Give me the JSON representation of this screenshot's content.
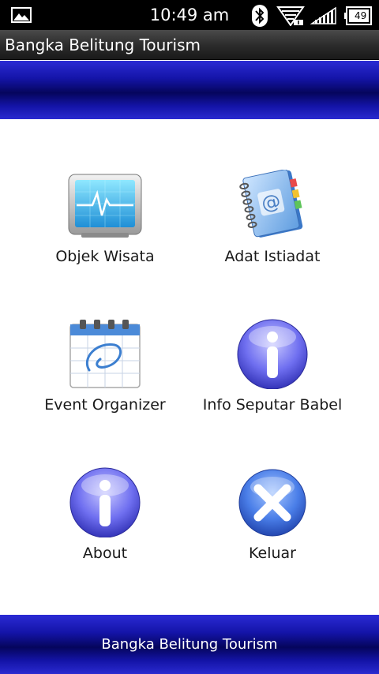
{
  "status_bar": {
    "time": "10:49 am",
    "battery_level": "49",
    "icons": [
      "gallery-icon",
      "bluetooth-icon",
      "wifi-icon",
      "signal-icon",
      "battery-icon"
    ]
  },
  "app": {
    "title": "Bangka Belitung Tourism"
  },
  "menu": [
    {
      "label": "Objek Wisata",
      "icon": "monitor-heartbeat-icon"
    },
    {
      "label": "Adat Istiadat",
      "icon": "address-book-icon"
    },
    {
      "label": "Event Organizer",
      "icon": "calendar-icon"
    },
    {
      "label": "Info Seputar Babel",
      "icon": "info-icon"
    },
    {
      "label": "About",
      "icon": "info-icon"
    },
    {
      "label": "Keluar",
      "icon": "close-icon"
    }
  ],
  "footer": {
    "text": "Bangka Belitung Tourism"
  },
  "colors": {
    "banner_blue": "#1414a8",
    "banner_dark": "#05055c",
    "status_bar": "#000000"
  }
}
